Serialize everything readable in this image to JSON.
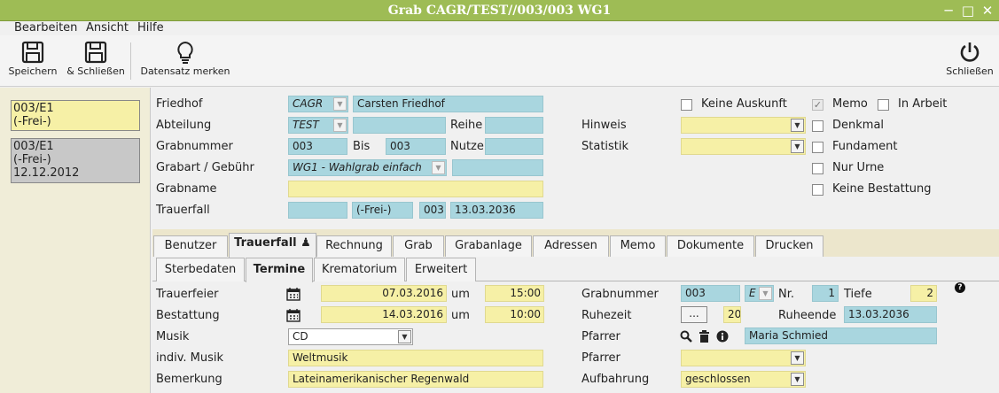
{
  "window": {
    "title": "Grab CAGR/TEST//003/003 WG1"
  },
  "menu": {
    "items": [
      "Bearbeiten",
      "Ansicht",
      "Hilfe"
    ]
  },
  "toolbar": {
    "save": "Speichern",
    "save_close": "& Schließen",
    "remember": "Datensatz merken",
    "close": "Schließen"
  },
  "left_cards": [
    {
      "line1": "003/E1",
      "line2": "(-Frei-)"
    },
    {
      "line1": "003/E1",
      "line2": "(-Frei-)",
      "line3": "12.12.2012"
    }
  ],
  "header": {
    "friedhof_label": "Friedhof",
    "friedhof_code": "CAGR",
    "friedhof_name": "Carsten Friedhof",
    "abteilung_label": "Abteilung",
    "abteilung_code": "TEST",
    "reihe_label": "Reihe",
    "grabnummer_label": "Grabnummer",
    "grabnummer_von": "003",
    "bis_label": "Bis",
    "grabnummer_bis": "003",
    "nutze_label": "Nutze",
    "grabart_label": "Grabart / Gebühr",
    "grabart_value": "WG1 - Wahlgrab einfach",
    "grabname_label": "Grabname",
    "trauerfall_label": "Trauerfall",
    "trauerfall_status": "(-Frei-)",
    "trauerfall_nr": "003",
    "trauerfall_date": "13.03.2036",
    "hinweis_label": "Hinweis",
    "statistik_label": "Statistik",
    "keine_auskunft": "Keine Auskunft",
    "memo": "Memo",
    "in_arbeit": "In Arbeit",
    "denkmal": "Denkmal",
    "fundament": "Fundament",
    "nur_urne": "Nur Urne",
    "keine_bestattung": "Keine Bestattung"
  },
  "tabs": [
    "Benutzer",
    "Trauerfall",
    "Rechnung",
    "Grab",
    "Grabanlage",
    "Adressen",
    "Memo",
    "Dokumente",
    "Drucken"
  ],
  "subtabs": [
    "Sterbedaten",
    "Termine",
    "Krematorium",
    "Erweitert"
  ],
  "termine": {
    "trauerfeier_label": "Trauerfeier",
    "trauerfeier_date": "07.03.2016",
    "um_label": "um",
    "trauerfeier_time": "15:00",
    "bestattung_label": "Bestattung",
    "bestattung_date": "14.03.2016",
    "bestattung_time": "10:00",
    "musik_label": "Musik",
    "musik_value": "CD",
    "indiv_musik_label": "indiv. Musik",
    "indiv_musik_value": "Weltmusik",
    "bemerkung_label": "Bemerkung",
    "bemerkung_value": "Lateinamerikanischer Regenwald",
    "grabnummer_label": "Grabnummer",
    "grabnummer_value": "003",
    "grab_suffix": "E",
    "nr_label": "Nr.",
    "nr_value": "1",
    "tiefe_label": "Tiefe",
    "tiefe_value": "2",
    "ruhezeit_label": "Ruhezeit",
    "ruhezeit_btn": "...",
    "ruhezeit_value": "20",
    "ruheende_label": "Ruheende",
    "ruheende_value": "13.03.2036",
    "pfarrer_label": "Pfarrer",
    "pfarrer_value": "Maria Schmied",
    "pfarrer2_label": "Pfarrer",
    "aufbahrung_label": "Aufbahrung",
    "aufbahrung_value": "geschlossen"
  },
  "help_glyph": "?",
  "colors": {
    "titlebar": "#9ebc55",
    "field_blue": "#a9d6df",
    "field_yellow": "#f6f0a6"
  }
}
